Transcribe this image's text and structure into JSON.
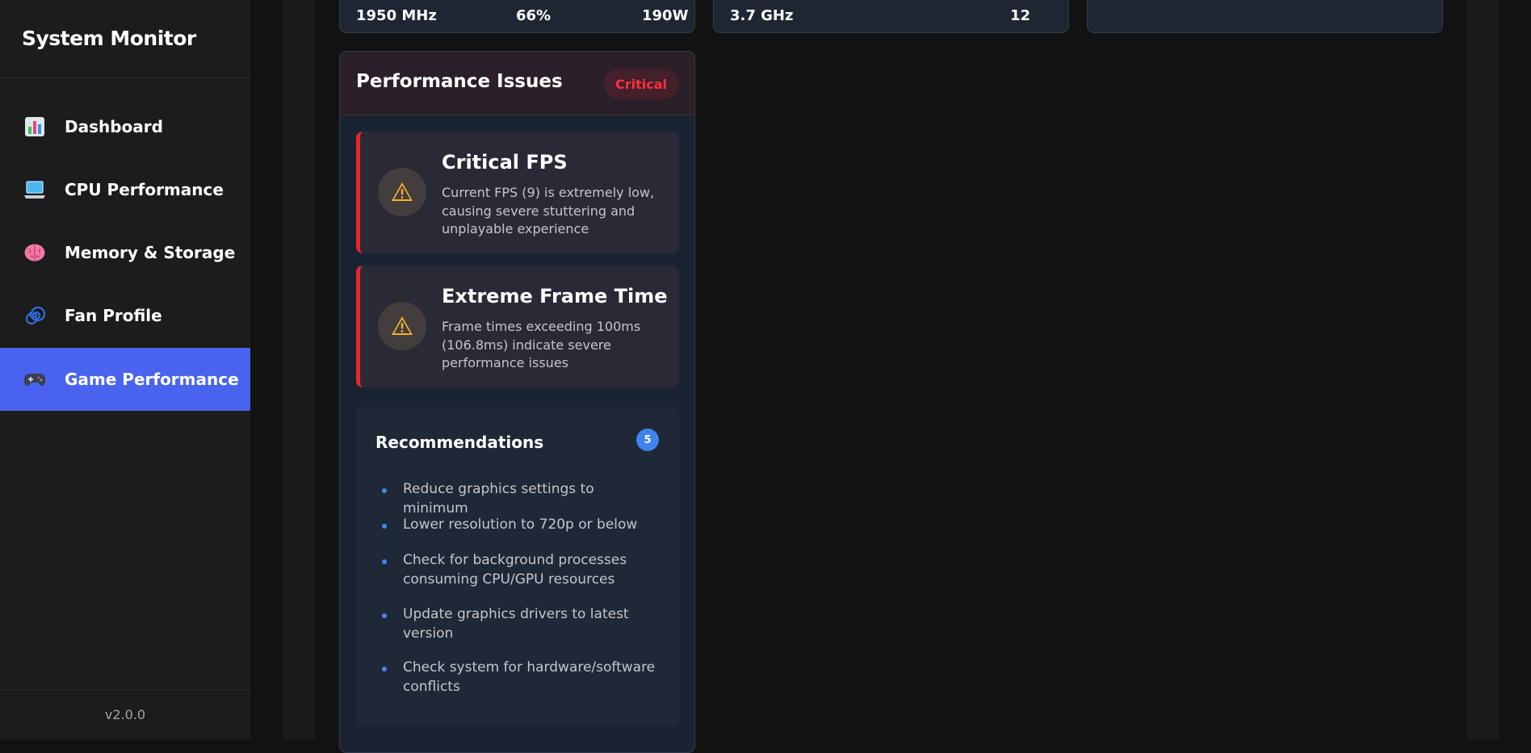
{
  "app": {
    "title": "System Monitor",
    "version": "v2.0.0"
  },
  "sidebar": {
    "items": [
      {
        "label": "Dashboard",
        "icon": "bar-chart-icon"
      },
      {
        "label": "CPU Performance",
        "icon": "laptop-icon"
      },
      {
        "label": "Memory & Storage",
        "icon": "brain-icon"
      },
      {
        "label": "Fan Profile",
        "icon": "fan-swirl-icon"
      },
      {
        "label": "Game Performance",
        "icon": "gamepad-icon",
        "active": true
      }
    ]
  },
  "top_cards": [
    {
      "values": [
        "1950 MHz",
        "66%",
        "190W"
      ]
    },
    {
      "values": [
        "3.7 GHz",
        "12"
      ]
    },
    {
      "values": []
    }
  ],
  "issues": {
    "title": "Performance Issues",
    "badge": "Critical",
    "items": [
      {
        "title": "Critical FPS",
        "description": "Current FPS (9) is extremely low, causing severe stuttering and unplayable experience",
        "icon": "warning-icon"
      },
      {
        "title": "Extreme Frame Time",
        "description": "Frame times exceeding 100ms (106.8ms) indicate severe performance issues",
        "icon": "warning-icon"
      }
    ]
  },
  "recommendations": {
    "title": "Recommendations",
    "count": "5",
    "items": [
      "Reduce graphics settings to minimum",
      "Lower resolution to 720p or below",
      "Check for background processes consuming CPU/GPU resources",
      "Update graphics drivers to latest version",
      "Check system for hardware/software conflicts"
    ]
  },
  "colors": {
    "accent": "#4a63ef",
    "critical": "#e8262f",
    "warning": "#f2b233",
    "info": "#3f83ed"
  }
}
